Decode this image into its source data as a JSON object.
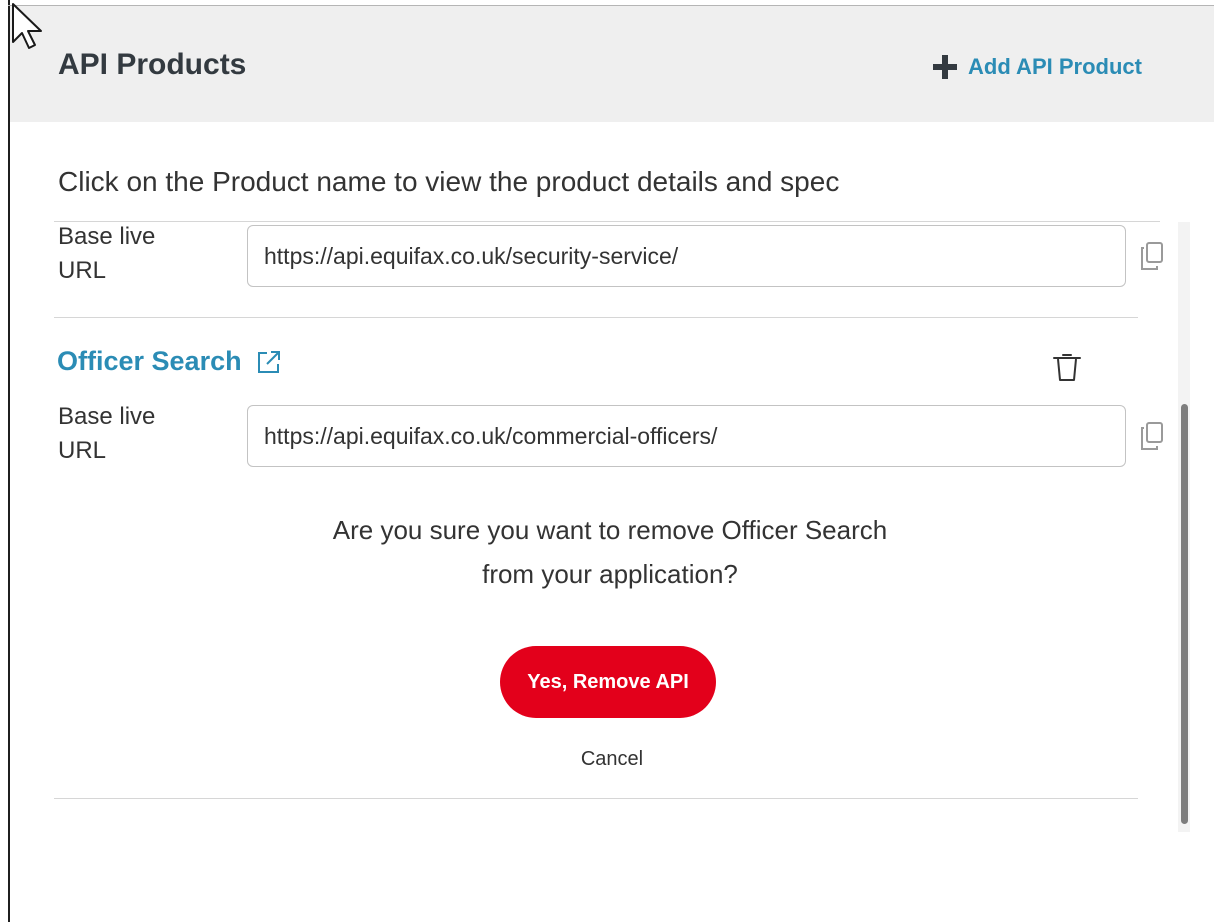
{
  "header": {
    "title": "API Products",
    "add_button_label": "Add API Product"
  },
  "instructions": "Click on the Product name to view the product details and spec",
  "products": [
    {
      "url_label": "Base live URL",
      "base_live_url": "https://api.equifax.co.uk/security-service/"
    },
    {
      "name": "Officer Search",
      "url_label": "Base live URL",
      "base_live_url": "https://api.equifax.co.uk/commercial-officers/"
    }
  ],
  "confirm_dialog": {
    "message_line1": "Are you sure you want to remove Officer Search",
    "message_line2": "from your application?",
    "confirm_label": "Yes, Remove API",
    "cancel_label": "Cancel"
  },
  "icons": {
    "add": "plus-icon",
    "external": "external-link-icon",
    "delete": "trash-icon",
    "copy": "copy-icon",
    "cursor": "mouse-pointer-icon"
  },
  "colors": {
    "accent": "#2b8cb5",
    "danger": "#e3001b",
    "header_bg": "#efefef"
  }
}
